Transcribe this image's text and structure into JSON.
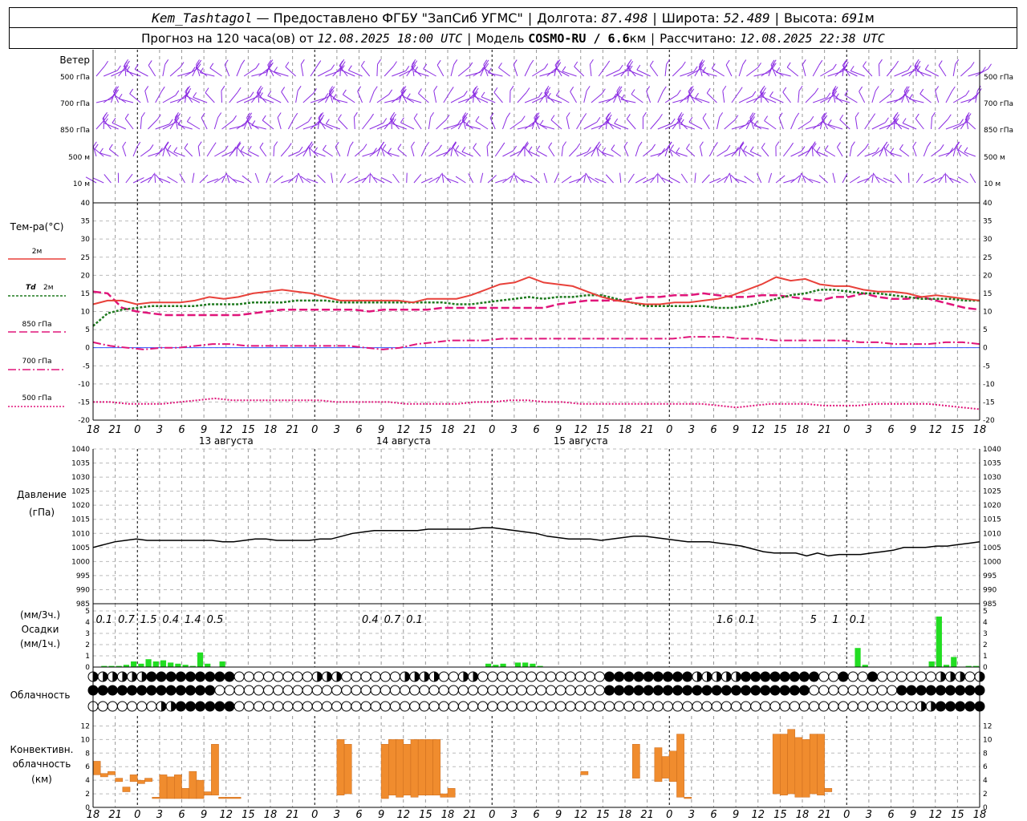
{
  "header": {
    "station": "Kem_Tashtagol",
    "provider": "— Предоставлено ФГБУ \"ЗапСиб УГМС\"",
    "lon_label": "Долгота:",
    "lon": "87.498",
    "lat_label": "Широта:",
    "lat": "52.489",
    "alt_label": "Высота:",
    "alt": "691",
    "alt_unit": "м",
    "forecast_label": "Прогноз на 120 часа(ов) от",
    "forecast_from": "12.08.2025 18:00 UTC",
    "model_label": "Модель",
    "model": "COSMO-RU / 6.6",
    "model_unit": "км",
    "calc_label": "Рассчитано:",
    "calc_time": "12.08.2025 22:38 UTC"
  },
  "labels": {
    "wind": "Ветер",
    "wind_levels": [
      "500 гПа",
      "700 гПа",
      "850 гПа",
      "500 м",
      "10 м"
    ],
    "temp_title": "Тем-ра(°C)",
    "legend_2m": "2м",
    "legend_td": "Td",
    "legend_td2": "2м",
    "legend_850": "850 гПа",
    "legend_700": "700 гПа",
    "legend_500": "500 гПа",
    "pressure_title": "Давление",
    "pressure_unit": "(гПа)",
    "precip_unit1": "(мм/3ч.)",
    "precip_title": "Осадки",
    "precip_unit2": "(мм/1ч.)",
    "cloud_title": "Облачность",
    "conv_title1": "Конвективн.",
    "conv_title2": "облачность",
    "conv_unit": "(км)"
  },
  "colors": {
    "t2m": "#e8413a",
    "td2m": "#1f7a1f",
    "t850": "#e0157a",
    "t700": "#e0157a",
    "t500": "#e0157a",
    "wind": "#8a2be2",
    "precip": "#22dd22",
    "conv": "#f08c2e",
    "zero_line": "#3355ff"
  },
  "chart_data": {
    "x_hours": [
      "18",
      "21",
      "0",
      "3",
      "6",
      "9",
      "12",
      "15",
      "18",
      "21",
      "0",
      "3",
      "6",
      "9",
      "12",
      "15",
      "18",
      "21",
      "0",
      "3",
      "6",
      "9",
      "12",
      "15",
      "18",
      "21",
      "0",
      "3",
      "6",
      "9",
      "12",
      "15",
      "18",
      "21",
      "0",
      "3",
      "6",
      "9",
      "12",
      "15",
      "18",
      "21",
      "0"
    ],
    "day_labels": [
      "13 августа",
      "14 августа",
      "15 августа"
    ],
    "temperature": {
      "type": "line",
      "ylim": [
        -20,
        40
      ],
      "yticks": [
        40,
        35,
        30,
        25,
        20,
        15,
        10,
        5,
        0,
        -5,
        -10,
        -15,
        -20
      ],
      "t2m": [
        12,
        13,
        13,
        12,
        12.5,
        12.5,
        12.5,
        13,
        14,
        13.5,
        14,
        15,
        15.5,
        16,
        15.5,
        15,
        14,
        13,
        13,
        13,
        13,
        13,
        12.5,
        13.5,
        13.5,
        13.5,
        14.5,
        16,
        17.5,
        18,
        19.5,
        18,
        17.5,
        17,
        15.5,
        14,
        13,
        12.5,
        12,
        12,
        12.5,
        12.5,
        13,
        13.5,
        14.5,
        16,
        17.5,
        19.5,
        18.5,
        19,
        17.5,
        17,
        17,
        16,
        15.5,
        15.5,
        15,
        14,
        14.5,
        14,
        13.5,
        13
      ],
      "td2m": [
        6,
        9.5,
        10.5,
        11,
        11.5,
        11.5,
        11.5,
        11.5,
        12,
        12,
        12,
        12.5,
        12.5,
        12.5,
        13,
        13,
        13,
        12.5,
        12.5,
        12.5,
        12.5,
        12.5,
        12.5,
        12.5,
        12.5,
        12,
        12,
        12.5,
        13,
        13.5,
        14,
        13.5,
        14,
        14,
        14.5,
        14.5,
        13.5,
        12.5,
        11.5,
        11.5,
        11.5,
        11.5,
        11.5,
        11,
        11,
        11.5,
        12.5,
        13.5,
        14.5,
        15,
        16,
        16,
        15.5,
        15,
        15,
        14.5,
        14,
        13.5,
        13.5,
        13.5,
        13,
        13
      ],
      "t850": [
        15.5,
        15,
        11,
        10,
        9.5,
        9,
        9,
        9,
        9,
        9,
        9,
        9.5,
        10,
        10.5,
        10.5,
        10.5,
        10.5,
        10.5,
        10.5,
        10,
        10.5,
        10.5,
        10.5,
        10.5,
        11,
        11,
        11,
        11,
        11,
        11,
        11,
        11,
        12,
        12.5,
        13,
        13,
        13,
        13.5,
        14,
        14,
        14.5,
        14.5,
        15,
        14.5,
        14,
        14,
        14.5,
        14.5,
        14,
        13.5,
        13,
        14,
        14,
        15,
        14,
        13.5,
        13.5,
        14,
        13,
        12,
        11,
        10.5
      ],
      "t700": [
        1.5,
        0.5,
        0,
        -0.5,
        0,
        0,
        0.5,
        1,
        1,
        0.5,
        0.5,
        0.5,
        0.5,
        0.5,
        0.5,
        0.5,
        0,
        -0.5,
        0,
        1,
        1.5,
        2,
        2,
        2,
        2.5,
        2.5,
        2.5,
        2.5,
        2.5,
        2.5,
        2.5,
        2.5,
        2.5,
        2.5,
        2.5,
        3,
        3,
        3,
        2.5,
        2.5,
        2,
        2,
        2,
        2,
        2,
        1.5,
        1.5,
        1,
        1,
        1,
        1.5,
        1.5,
        1
      ],
      "t500": [
        -15,
        -15,
        -15.5,
        -15.5,
        -15.5,
        -15,
        -14.5,
        -14,
        -14.5,
        -14.5,
        -14.5,
        -14.5,
        -14.5,
        -14.5,
        -15,
        -15,
        -15,
        -15,
        -15.5,
        -15.5,
        -15.5,
        -15.5,
        -15,
        -15,
        -14.5,
        -14.5,
        -15,
        -15,
        -15.5,
        -15.5,
        -15.5,
        -15.5,
        -15.5,
        -15.5,
        -15.5,
        -15.5,
        -16,
        -16.5,
        -16,
        -15.5,
        -15.5,
        -15.5,
        -16,
        -16,
        -16,
        -15.5,
        -15.5,
        -15.5,
        -15.5,
        -16,
        -16.5,
        -17
      ]
    },
    "pressure": {
      "type": "line",
      "ylim": [
        985,
        1040
      ],
      "yticks": [
        1040,
        1035,
        1030,
        1025,
        1020,
        1015,
        1010,
        1005,
        1000,
        995,
        990,
        985
      ],
      "values": [
        1005,
        1006,
        1007,
        1007.5,
        1008,
        1007.5,
        1007.5,
        1007.5,
        1007.5,
        1007.5,
        1007.5,
        1007.5,
        1007,
        1007,
        1007.5,
        1008,
        1008,
        1007.5,
        1007.5,
        1007.5,
        1007.5,
        1008,
        1008,
        1009,
        1010,
        1010.5,
        1011,
        1011,
        1011,
        1011,
        1011,
        1011.5,
        1011.5,
        1011.5,
        1011.5,
        1011.5,
        1012,
        1012,
        1011.5,
        1011,
        1010.5,
        1010,
        1009,
        1008.5,
        1008,
        1008,
        1008,
        1007.5,
        1008,
        1008.5,
        1009,
        1009,
        1008.5,
        1008,
        1007.5,
        1007,
        1007,
        1007,
        1006.5,
        1006,
        1005.5,
        1004.5,
        1003.5,
        1003,
        1003,
        1003,
        1002,
        1003,
        1002,
        1002.5,
        1002.5,
        1002.5,
        1003,
        1003.5,
        1004,
        1005,
        1005,
        1005,
        1005.5,
        1005.5,
        1006,
        1006.5,
        1007
      ]
    },
    "precipitation": {
      "type": "bar",
      "ylim": [
        0,
        5
      ],
      "yticks": [
        5,
        4,
        3,
        2,
        1,
        0
      ],
      "labels_3h": [
        {
          "hour": 19.5,
          "text": "0.1"
        },
        {
          "hour": 22.5,
          "text": "0.7"
        },
        {
          "hour": 25.5,
          "text": "1.5"
        },
        {
          "hour": 28.5,
          "text": "0.4"
        },
        {
          "hour": 31.5,
          "text": "1.4"
        },
        {
          "hour": 34.5,
          "text": "0.5"
        },
        {
          "hour": 55.5,
          "text": "0.4"
        },
        {
          "hour": 58.5,
          "text": "0.7"
        },
        {
          "hour": 61.5,
          "text": "0.1"
        },
        {
          "hour": 103.5,
          "text": "1.6"
        },
        {
          "hour": 106.5,
          "text": "0.1"
        },
        {
          "hour": 115.5,
          "text": "5"
        },
        {
          "hour": 118.5,
          "text": "1"
        },
        {
          "hour": 121.5,
          "text": "0.1"
        }
      ],
      "hourly": [
        0,
        0.1,
        0.1,
        0.1,
        0.2,
        0.5,
        0.3,
        0.7,
        0.5,
        0.6,
        0.4,
        0.3,
        0.2,
        0.1,
        1.3,
        0.3,
        0,
        0.5,
        0,
        0,
        0,
        0,
        0,
        0,
        0,
        0,
        0,
        0,
        0,
        0,
        0,
        0,
        0,
        0,
        0,
        0,
        0,
        0,
        0,
        0,
        0,
        0,
        0,
        0,
        0,
        0,
        0,
        0,
        0,
        0,
        0,
        0,
        0,
        0.3,
        0.2,
        0.3,
        0,
        0.4,
        0.4,
        0.3,
        0.1,
        0,
        0,
        0,
        0,
        0,
        0,
        0,
        0,
        0,
        0,
        0,
        0,
        0,
        0,
        0,
        0,
        0,
        0,
        0,
        0,
        0,
        0,
        0,
        0,
        0,
        0,
        0,
        0,
        0,
        0,
        0,
        0,
        0,
        0,
        0,
        0,
        0,
        0,
        0,
        0,
        0,
        0,
        1.7,
        0.2,
        0,
        0,
        0,
        0,
        0,
        0,
        0,
        0,
        0.5,
        4.5,
        0.2,
        0.9,
        0,
        0.1,
        0.1,
        0,
        0
      ]
    },
    "cloud_rows": [
      "ccccccdddddddddoooooooocccooooooccccooccooooooooooooodddddddddcccccddddddddoodoodoooooocccocccccc",
      "dddddddddddddoooooooooooooooooooooooooooooooooooooooodddddddddddddddddddddooooooooodddddddddddddd",
      "oooooooccddddddooooooooooooooooooooooooooooooooooooooooooooooooooooooooooooooooooooooccdddddoooooo"
    ],
    "convective": {
      "type": "bar",
      "ylim": [
        0,
        13
      ],
      "yticks": [
        12,
        10,
        8,
        6,
        4,
        2,
        0
      ],
      "bars": [
        {
          "h0": 18,
          "h1": 19,
          "lo": 4.8,
          "hi": 6.8
        },
        {
          "h0": 19,
          "h1": 20,
          "lo": 4.5,
          "hi": 5
        },
        {
          "h0": 20,
          "h1": 21,
          "lo": 4.8,
          "hi": 5.3
        },
        {
          "h0": 21,
          "h1": 22,
          "lo": 3.8,
          "hi": 4.3
        },
        {
          "h0": 22,
          "h1": 23,
          "lo": 2.3,
          "hi": 3
        },
        {
          "h0": 23,
          "h1": 24,
          "lo": 3.8,
          "hi": 4.8
        },
        {
          "h0": 24,
          "h1": 25,
          "lo": 3.5,
          "hi": 4
        },
        {
          "h0": 25,
          "h1": 26,
          "lo": 3.8,
          "hi": 4.3
        },
        {
          "h0": 26,
          "h1": 27,
          "lo": 1.3,
          "hi": 1.5
        },
        {
          "h0": 27,
          "h1": 28,
          "lo": 1.3,
          "hi": 4.8
        },
        {
          "h0": 28,
          "h1": 29,
          "lo": 1.3,
          "hi": 4.5
        },
        {
          "h0": 29,
          "h1": 30,
          "lo": 1.3,
          "hi": 4.8
        },
        {
          "h0": 30,
          "h1": 31,
          "lo": 1.3,
          "hi": 2.8
        },
        {
          "h0": 31,
          "h1": 32,
          "lo": 1.3,
          "hi": 5.3
        },
        {
          "h0": 32,
          "h1": 33,
          "lo": 1.3,
          "hi": 4
        },
        {
          "h0": 33,
          "h1": 34,
          "lo": 1.8,
          "hi": 2.3
        },
        {
          "h0": 34,
          "h1": 35,
          "lo": 1.8,
          "hi": 9.3
        },
        {
          "h0": 35,
          "h1": 36,
          "lo": 1.3,
          "hi": 1.5
        },
        {
          "h0": 36,
          "h1": 38,
          "lo": 1.3,
          "hi": 1.5
        },
        {
          "h0": 51,
          "h1": 52,
          "lo": 1.8,
          "hi": 10
        },
        {
          "h0": 52,
          "h1": 53,
          "lo": 2,
          "hi": 9.3
        },
        {
          "h0": 57,
          "h1": 58,
          "lo": 1.3,
          "hi": 9.3
        },
        {
          "h0": 58,
          "h1": 59,
          "lo": 1.8,
          "hi": 10
        },
        {
          "h0": 59,
          "h1": 60,
          "lo": 1.5,
          "hi": 10
        },
        {
          "h0": 60,
          "h1": 61,
          "lo": 1.8,
          "hi": 9.3
        },
        {
          "h0": 61,
          "h1": 62,
          "lo": 1.5,
          "hi": 10
        },
        {
          "h0": 62,
          "h1": 63,
          "lo": 1.8,
          "hi": 10
        },
        {
          "h0": 63,
          "h1": 64,
          "lo": 1.8,
          "hi": 10
        },
        {
          "h0": 64,
          "h1": 65,
          "lo": 1.8,
          "hi": 10
        },
        {
          "h0": 65,
          "h1": 66,
          "lo": 1.5,
          "hi": 2
        },
        {
          "h0": 66,
          "h1": 67,
          "lo": 1.5,
          "hi": 2.8
        },
        {
          "h0": 84,
          "h1": 85,
          "lo": 4.8,
          "hi": 5.3
        },
        {
          "h0": 91,
          "h1": 92,
          "lo": 4.3,
          "hi": 9.3
        },
        {
          "h0": 94,
          "h1": 95,
          "lo": 3.8,
          "hi": 8.8
        },
        {
          "h0": 95,
          "h1": 96,
          "lo": 4.3,
          "hi": 7.5
        },
        {
          "h0": 96,
          "h1": 97,
          "lo": 3.8,
          "hi": 8.3
        },
        {
          "h0": 97,
          "h1": 98,
          "lo": 1.5,
          "hi": 10.8
        },
        {
          "h0": 98,
          "h1": 99,
          "lo": 1.3,
          "hi": 1.5
        },
        {
          "h0": 110,
          "h1": 111,
          "lo": 2,
          "hi": 10.8
        },
        {
          "h0": 111,
          "h1": 112,
          "lo": 1.8,
          "hi": 10.8
        },
        {
          "h0": 112,
          "h1": 113,
          "lo": 2,
          "hi": 11.5
        },
        {
          "h0": 113,
          "h1": 114,
          "lo": 1.5,
          "hi": 10.3
        },
        {
          "h0": 114,
          "h1": 115,
          "lo": 1.5,
          "hi": 10
        },
        {
          "h0": 115,
          "h1": 116,
          "lo": 2,
          "hi": 10.8
        },
        {
          "h0": 116,
          "h1": 117,
          "lo": 1.8,
          "hi": 10.8
        },
        {
          "h0": 117,
          "h1": 118,
          "lo": 2.3,
          "hi": 2.8
        }
      ]
    }
  }
}
